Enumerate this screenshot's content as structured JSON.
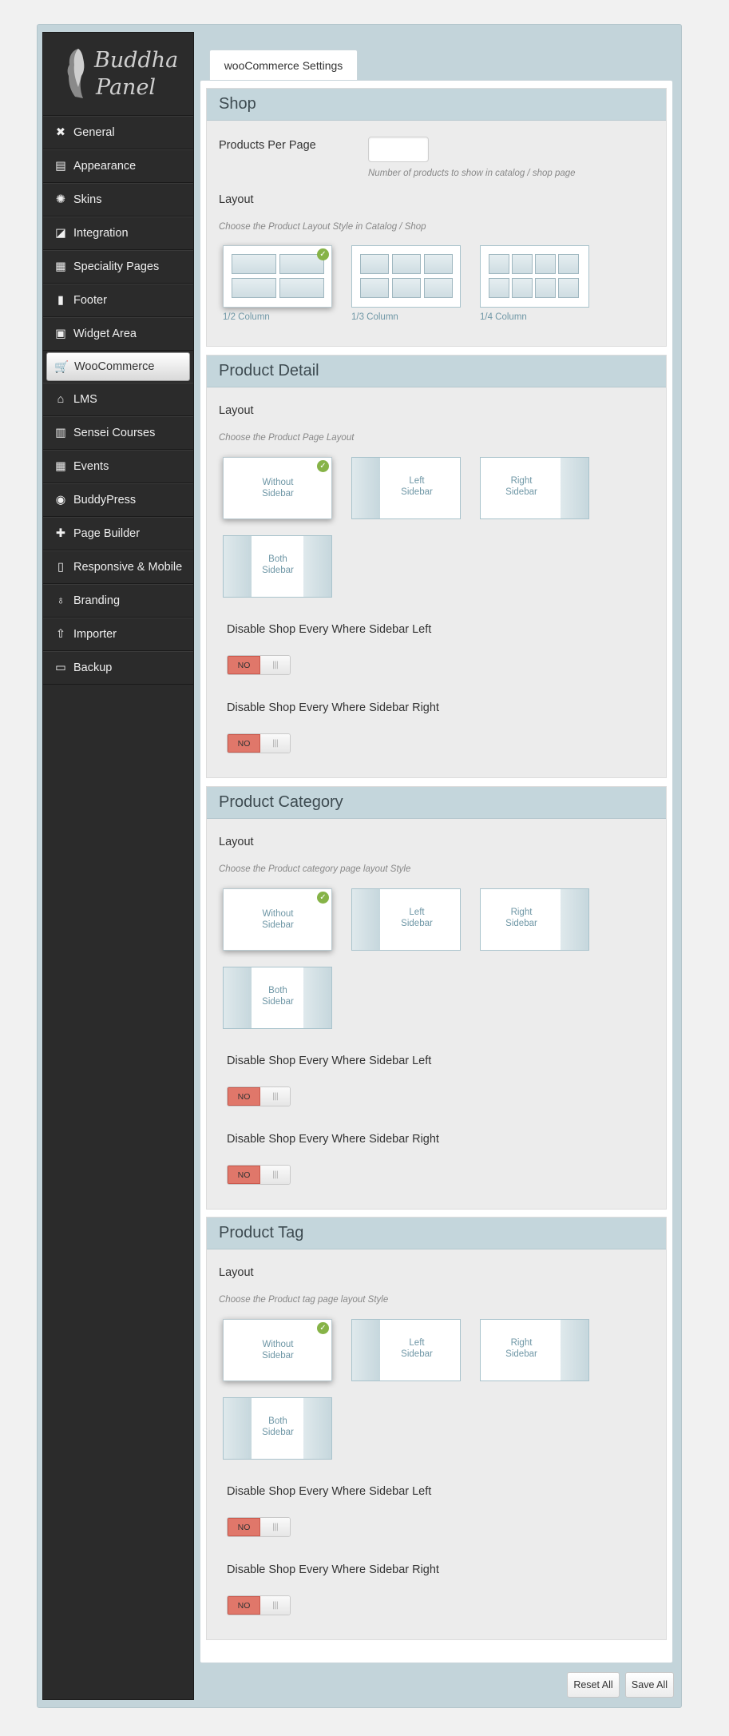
{
  "brand": {
    "line1": "Buddha",
    "line2": "Panel"
  },
  "nav": [
    {
      "label": "General",
      "icon": "wrench-icon"
    },
    {
      "label": "Appearance",
      "icon": "appearance-icon"
    },
    {
      "label": "Skins",
      "icon": "skins-icon"
    },
    {
      "label": "Integration",
      "icon": "integration-icon"
    },
    {
      "label": "Speciality Pages",
      "icon": "grid-icon"
    },
    {
      "label": "Footer",
      "icon": "footer-icon"
    },
    {
      "label": "Widget Area",
      "icon": "widget-icon"
    },
    {
      "label": "WooCommerce",
      "icon": "cart-icon"
    },
    {
      "label": "LMS",
      "icon": "graduation-cap-icon"
    },
    {
      "label": "Sensei Courses",
      "icon": "courses-icon"
    },
    {
      "label": "Events",
      "icon": "calendar-icon"
    },
    {
      "label": "BuddyPress",
      "icon": "buddypress-icon"
    },
    {
      "label": "Page Builder",
      "icon": "page-builder-icon"
    },
    {
      "label": "Responsive & Mobile",
      "icon": "mobile-icon"
    },
    {
      "label": "Branding",
      "icon": "bulb-icon"
    },
    {
      "label": "Importer",
      "icon": "upload-icon"
    },
    {
      "label": "Backup",
      "icon": "briefcase-icon"
    }
  ],
  "active_nav": "WooCommerce",
  "tab": "wooCommerce Settings",
  "shop": {
    "title": "Shop",
    "products_per_page_label": "Products Per Page",
    "products_per_page_value": "",
    "products_per_page_desc": "Number of products to show in catalog / shop page",
    "layout_label": "Layout",
    "layout_desc": "Choose the Product Layout Style in Catalog / Shop",
    "columns": [
      "1/2 Column",
      "1/3 Column",
      "1/4 Column"
    ],
    "selected_column": "1/2 Column"
  },
  "sections": [
    {
      "title": "Product Detail",
      "layout_label": "Layout",
      "layout_desc": "Choose the Product Page Layout",
      "options": [
        "Without Sidebar",
        "Left Sidebar",
        "Right Sidebar",
        "Both Sidebar"
      ],
      "selected": "Without Sidebar",
      "toggle1_label": "Disable Shop Every Where Sidebar Left",
      "toggle2_label": "Disable Shop Every Where Sidebar Right",
      "toggle_value": "NO"
    },
    {
      "title": "Product Category",
      "layout_label": "Layout",
      "layout_desc": "Choose the Product category page layout Style",
      "options": [
        "Without Sidebar",
        "Left Sidebar",
        "Right Sidebar",
        "Both Sidebar"
      ],
      "selected": "Without Sidebar",
      "toggle1_label": "Disable Shop Every Where Sidebar Left",
      "toggle2_label": "Disable Shop Every Where Sidebar Right",
      "toggle_value": "NO"
    },
    {
      "title": "Product Tag",
      "layout_label": "Layout",
      "layout_desc": "Choose the Product tag page layout Style",
      "options": [
        "Without Sidebar",
        "Left Sidebar",
        "Right Sidebar",
        "Both Sidebar"
      ],
      "selected": "Without Sidebar",
      "toggle1_label": "Disable Shop Every Where Sidebar Left",
      "toggle2_label": "Disable Shop Every Where Sidebar Right",
      "toggle_value": "NO"
    }
  ],
  "buttons": {
    "reset": "Reset All",
    "save": "Save All"
  },
  "colors": {
    "accent": "#c4d6dc",
    "toggle_off": "#e0776a",
    "check": "#86b347",
    "sidebar": "#2b2b2b"
  }
}
